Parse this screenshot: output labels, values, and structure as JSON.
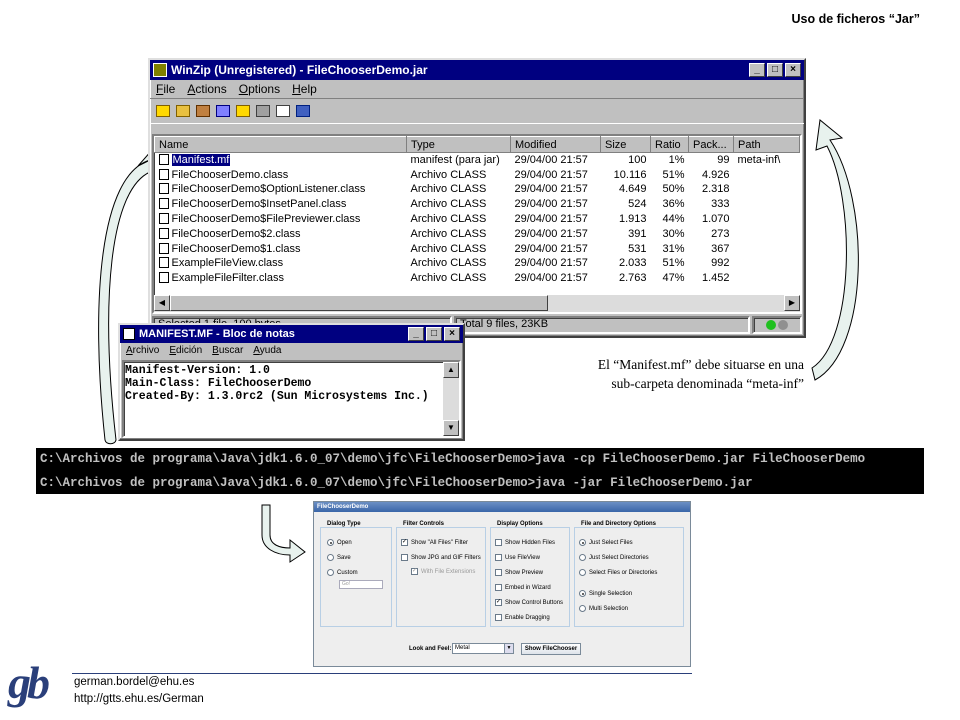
{
  "slide": {
    "header_title": "Uso de ficheros “Jar”",
    "annotation": [
      "El “Manifest.mf” debe situarse en una",
      "sub-carpeta denominada “meta-inf”"
    ],
    "footer": {
      "logo": "gb",
      "email": "german.bordel@ehu.es",
      "url": "http://gtts.ehu.es/German"
    }
  },
  "winzip": {
    "title": "WinZip (Unregistered) - FileChooserDemo.jar",
    "menu": [
      "File",
      "Actions",
      "Options",
      "Help"
    ],
    "toolbar_icons": [
      "new-icon",
      "open-icon",
      "favorites-icon",
      "add-icon",
      "extract-icon",
      "view-icon",
      "checkout-icon",
      "wizard-icon"
    ],
    "columns": [
      "Name",
      "Type",
      "Modified",
      "Size",
      "Ratio",
      "Pack...",
      "Path"
    ],
    "rows": [
      [
        "Manifest.mf",
        "manifest (para jar)",
        "29/04/00 21:57",
        "100",
        "1%",
        "99",
        "meta-inf\\"
      ],
      [
        "FileChooserDemo.class",
        "Archivo CLASS",
        "29/04/00 21:57",
        "10.116",
        "51%",
        "4.926",
        ""
      ],
      [
        "FileChooserDemo$OptionListener.class",
        "Archivo CLASS",
        "29/04/00 21:57",
        "4.649",
        "50%",
        "2.318",
        ""
      ],
      [
        "FileChooserDemo$InsetPanel.class",
        "Archivo CLASS",
        "29/04/00 21:57",
        "524",
        "36%",
        "333",
        ""
      ],
      [
        "FileChooserDemo$FilePreviewer.class",
        "Archivo CLASS",
        "29/04/00 21:57",
        "1.913",
        "44%",
        "1.070",
        ""
      ],
      [
        "FileChooserDemo$2.class",
        "Archivo CLASS",
        "29/04/00 21:57",
        "391",
        "30%",
        "273",
        ""
      ],
      [
        "FileChooserDemo$1.class",
        "Archivo CLASS",
        "29/04/00 21:57",
        "531",
        "31%",
        "367",
        ""
      ],
      [
        "ExampleFileView.class",
        "Archivo CLASS",
        "29/04/00 21:57",
        "2.033",
        "51%",
        "992",
        ""
      ],
      [
        "ExampleFileFilter.class",
        "Archivo CLASS",
        "29/04/00 21:57",
        "2.763",
        "47%",
        "1.452",
        ""
      ]
    ],
    "status_left": "Selected 1 file, 100 bytes",
    "status_right": "Total 9 files, 23KB"
  },
  "notepad": {
    "title": "MANIFEST.MF - Bloc de notas",
    "menu": [
      "Archivo",
      "Edición",
      "Buscar",
      "Ayuda"
    ],
    "lines": [
      "Manifest-Version: 1.0",
      "Main-Class: FileChooserDemo",
      "Created-By: 1.3.0rc2 (Sun Microsystems Inc.)"
    ]
  },
  "console": {
    "lines": [
      "C:\\Archivos de programa\\Java\\jdk1.6.0_07\\demo\\jfc\\FileChooserDemo>java -cp FileChooserDemo.jar FileChooserDemo",
      "C:\\Archivos de programa\\Java\\jdk1.6.0_07\\demo\\jfc\\FileChooserDemo>java -jar FileChooserDemo.jar"
    ]
  },
  "demo": {
    "title": "FileChooserDemo",
    "dialog_type": {
      "title": "Dialog Type",
      "options": [
        "Open",
        "Save",
        "Custom"
      ],
      "selected": "Open",
      "custom_placeholder": "Go!"
    },
    "filter_controls": {
      "title": "Filter Controls",
      "options": [
        "Show \"All Files\" Filter",
        "Show JPG and GIF Filters",
        "With File Extensions"
      ],
      "checked": [
        true,
        false,
        true
      ]
    },
    "display_options": {
      "title": "Display Options",
      "options": [
        "Show Hidden Files",
        "Use FileView",
        "Show Preview",
        "Embed in Wizard",
        "Show Control Buttons",
        "Enable Dragging"
      ],
      "checked": [
        false,
        false,
        false,
        false,
        true,
        false
      ]
    },
    "file_dir_options": {
      "title": "File and Directory Options",
      "options": [
        "Just Select Files",
        "Just Select Directories",
        "Select Files or Directories"
      ],
      "selection": [
        "Single Selection",
        "Multi Selection"
      ]
    },
    "look_and_feel_label": "Look and Feel:",
    "look_and_feel_value": "Metal",
    "show_button": "Show FileChooser"
  }
}
